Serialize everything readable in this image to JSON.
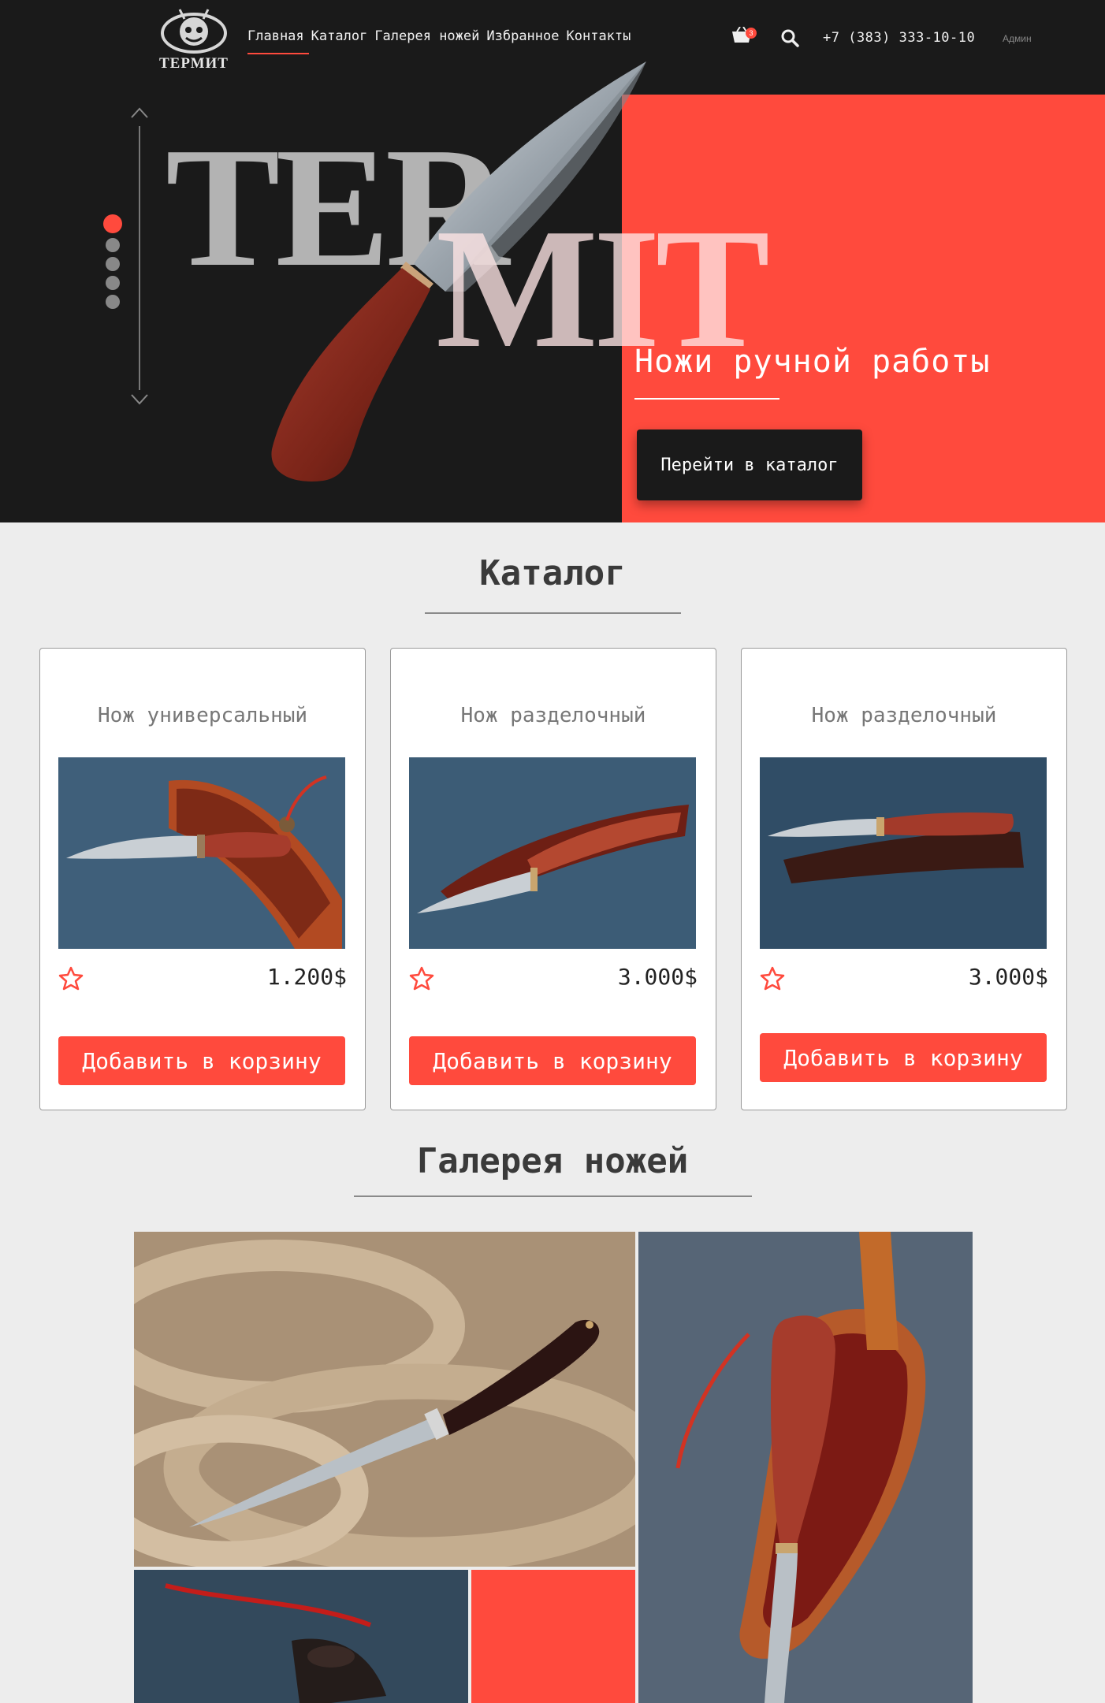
{
  "logo": {
    "text": "ТЕРМИТ"
  },
  "nav": {
    "items": [
      "Главная",
      "Каталог",
      "Галерея ножей",
      "Избранное",
      "Контакты"
    ],
    "cart_count": "3",
    "phone": "+7 (383) 333-10-10",
    "admin": "Админ"
  },
  "hero": {
    "word_part1": "TER",
    "word_part2": "MIT",
    "subtitle": "Ножи ручной работы",
    "button": "Перейти в каталог",
    "slides_total": 5,
    "active_slide": 1
  },
  "catalog": {
    "title": "Каталог",
    "cards": [
      {
        "title": "Нож универсальный",
        "price": "1.200$",
        "button": "Добавить в корзину"
      },
      {
        "title": "Нож разделочный",
        "price": "3.000$",
        "button": "Добавить в корзину"
      },
      {
        "title": "Нож разделочный",
        "price": "3.000$",
        "button": "Добавить в корзину"
      }
    ]
  },
  "gallery": {
    "title": "Галерея ножей"
  },
  "colors": {
    "accent": "#ff4a3d",
    "dark": "#1a1a1a",
    "background": "#ededed"
  }
}
